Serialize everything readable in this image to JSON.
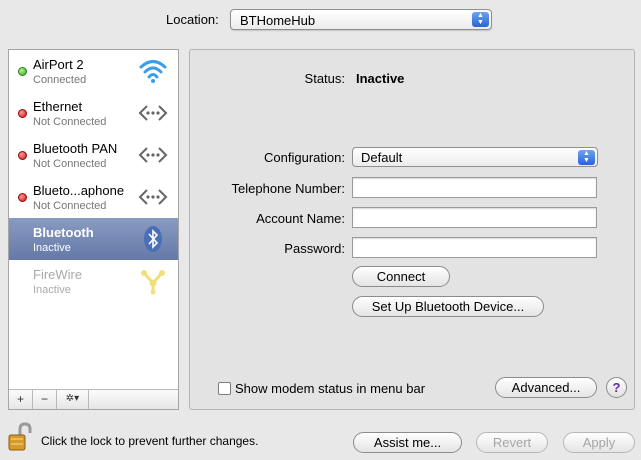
{
  "location": {
    "label": "Location:",
    "value": "BTHomeHub"
  },
  "services": [
    {
      "name": "AirPort 2",
      "status": "Connected",
      "indicator": "green",
      "icon": "wifi-icon"
    },
    {
      "name": "Ethernet",
      "status": "Not Connected",
      "indicator": "red",
      "icon": "ethernet-icon"
    },
    {
      "name": "Bluetooth PAN",
      "status": "Not Connected",
      "indicator": "red",
      "icon": "ethernet-icon"
    },
    {
      "name": "Blueto...aphone",
      "status": "Not Connected",
      "indicator": "red",
      "icon": "ethernet-icon"
    },
    {
      "name": "Bluetooth",
      "status": "Inactive",
      "selected": true,
      "icon": "bluetooth-icon"
    },
    {
      "name": "FireWire",
      "status": "Inactive",
      "disabled": true,
      "icon": "firewire-icon"
    }
  ],
  "sidebar_toolbar": {
    "add": "+",
    "remove": "−",
    "actions": "✲▾"
  },
  "detail": {
    "status_label": "Status:",
    "status_value": "Inactive",
    "configuration_label": "Configuration:",
    "configuration_value": "Default",
    "telephone_label": "Telephone Number:",
    "telephone_value": "",
    "account_label": "Account Name:",
    "account_value": "",
    "password_label": "Password:",
    "password_value": "",
    "connect_button": "Connect",
    "setup_button": "Set Up Bluetooth Device...",
    "modem_checkbox_label": "Show modem status in menu bar",
    "modem_checkbox_checked": false,
    "advanced_button": "Advanced...",
    "help_button": "?"
  },
  "footer": {
    "lock_text": "Click the lock to prevent further changes.",
    "assist_button": "Assist me...",
    "revert_button": "Revert",
    "apply_button": "Apply"
  },
  "colors": {
    "selection": "#7284b0",
    "connected": "#2fa80f",
    "not_connected": "#d60f0f",
    "accent": "#2a63d6"
  }
}
